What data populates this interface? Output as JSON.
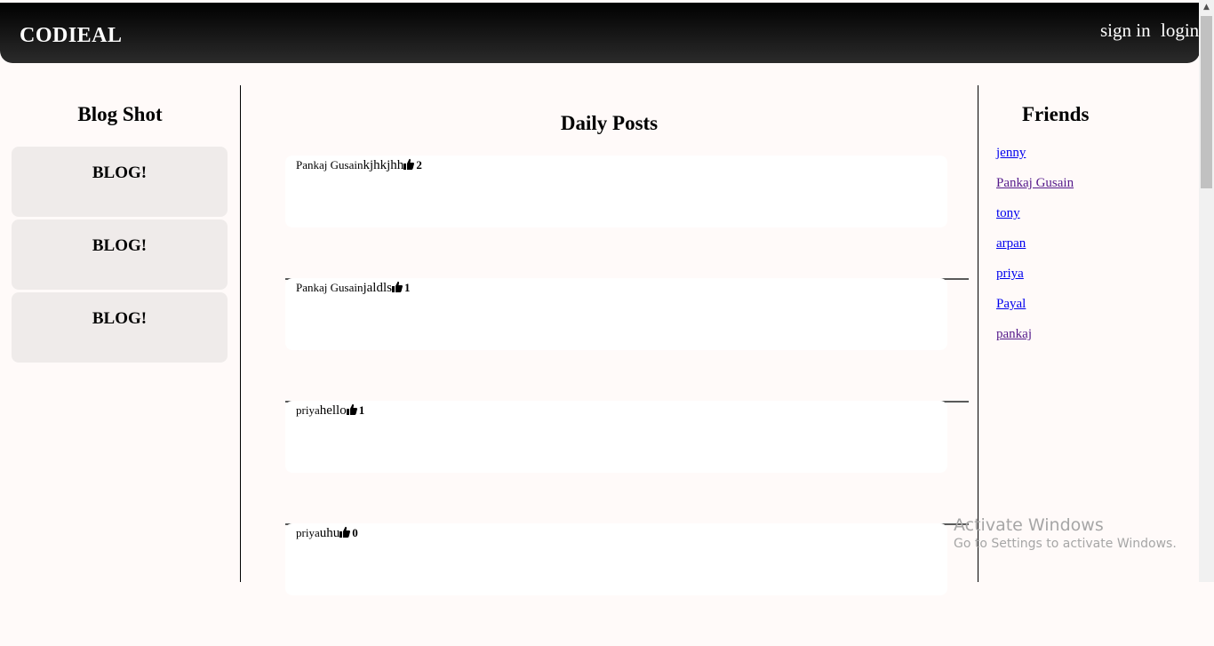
{
  "navbar": {
    "brand": "CODIEAL",
    "sign_in": "sign in",
    "login": "login"
  },
  "left": {
    "title": "Blog Shot",
    "blogs": [
      "BLOG!",
      "BLOG!",
      "BLOG!"
    ]
  },
  "main": {
    "title": "Daily Posts",
    "posts": [
      {
        "author": "Pankaj Gusain",
        "content": "kjhkjhh",
        "likes": "2"
      },
      {
        "author": "Pankaj Gusain",
        "content": "jaldls",
        "likes": "1"
      },
      {
        "author": "priya",
        "content": "hello",
        "likes": "1"
      },
      {
        "author": "priya",
        "content": "uhu",
        "likes": "0"
      }
    ]
  },
  "friends": {
    "title": "Friends",
    "list": [
      "jenny",
      "Pankaj Gusain",
      "tony",
      "arpan",
      "priya",
      "Payal",
      "pankaj"
    ]
  },
  "watermark": {
    "title": "Activate Windows",
    "subtitle": "Go to Settings to activate Windows."
  },
  "icons": {
    "like": "thumbs-up-icon",
    "scroll_up": "chevron-up-icon"
  }
}
